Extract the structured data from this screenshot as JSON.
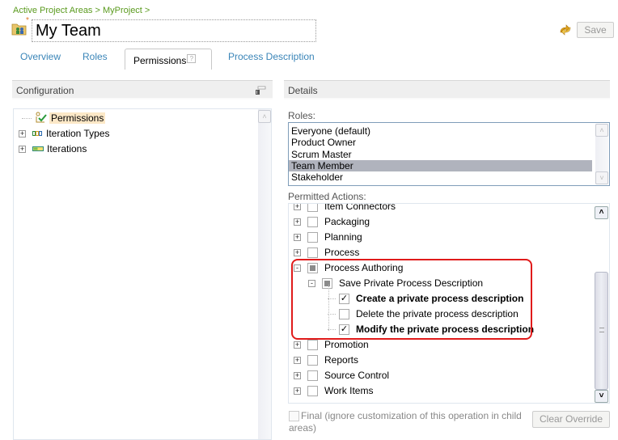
{
  "header": {
    "breadcrumb": "Active Project Areas > MyProject >",
    "dirty_marker": "*",
    "title": "My Team",
    "title_icon": "team-area-icon",
    "sync_icon": "refresh-sync-icon",
    "save_label": "Save"
  },
  "tabs": [
    {
      "label": "Overview",
      "active": false
    },
    {
      "label": "Roles",
      "active": false
    },
    {
      "label": "Permissions",
      "active": true,
      "help": "?"
    },
    {
      "label": "Process Description",
      "active": false
    }
  ],
  "configuration": {
    "title": "Configuration",
    "tree": [
      {
        "label": "Permissions",
        "icon": "permissions-check-icon",
        "expandable": false,
        "selected": true
      },
      {
        "label": "Iteration Types",
        "icon": "iteration-types-icon",
        "expandable": true,
        "expander": "+"
      },
      {
        "label": "Iterations",
        "icon": "iterations-icon",
        "expandable": true,
        "expander": "+"
      }
    ]
  },
  "details": {
    "title": "Details",
    "roles_label": "Roles:",
    "roles": [
      {
        "label": "Everyone (default)",
        "selected": false
      },
      {
        "label": "Product Owner",
        "selected": false
      },
      {
        "label": "Scrum Master",
        "selected": false
      },
      {
        "label": "Team Member",
        "selected": true
      },
      {
        "label": "Stakeholder",
        "selected": false
      }
    ],
    "permitted_actions_label": "Permitted Actions:",
    "actions": [
      {
        "label": "Item Connectors",
        "expander": "+",
        "state": "unchecked",
        "level": 0
      },
      {
        "label": "Packaging",
        "expander": "+",
        "state": "unchecked",
        "level": 0
      },
      {
        "label": "Planning",
        "expander": "+",
        "state": "unchecked",
        "level": 0
      },
      {
        "label": "Process",
        "expander": "+",
        "state": "unchecked",
        "level": 0
      },
      {
        "label": "Process Authoring",
        "expander": "-",
        "state": "partial",
        "level": 0
      },
      {
        "label": "Save Private Process Description",
        "expander": "-",
        "state": "partial",
        "level": 1
      },
      {
        "label": "Create a private process description",
        "state": "checked",
        "level": 2,
        "bold": true
      },
      {
        "label": "Delete the private process description",
        "state": "unchecked",
        "level": 2,
        "bold": false
      },
      {
        "label": "Modify the private process description",
        "state": "checked",
        "level": 2,
        "bold": true
      },
      {
        "label": "Promotion",
        "expander": "+",
        "state": "unchecked",
        "level": 0
      },
      {
        "label": "Reports",
        "expander": "+",
        "state": "unchecked",
        "level": 0
      },
      {
        "label": "Source Control",
        "expander": "+",
        "state": "unchecked",
        "level": 0
      },
      {
        "label": "Work Items",
        "expander": "+",
        "state": "unchecked",
        "level": 0
      }
    ],
    "final_label": "Final (ignore customization of this operation in child areas)",
    "final_checked": false,
    "clear_override_label": "Clear Override",
    "check_glyph": "✓",
    "scroll_up": "˄",
    "scroll_down": "˅"
  },
  "colors": {
    "breadcrumb": "#5a9a1e",
    "tab_link": "#3a85b8",
    "highlight_border": "#e01b1b",
    "selected_role": "#b0b3bd",
    "selected_tree_item": "#fce8c7"
  }
}
